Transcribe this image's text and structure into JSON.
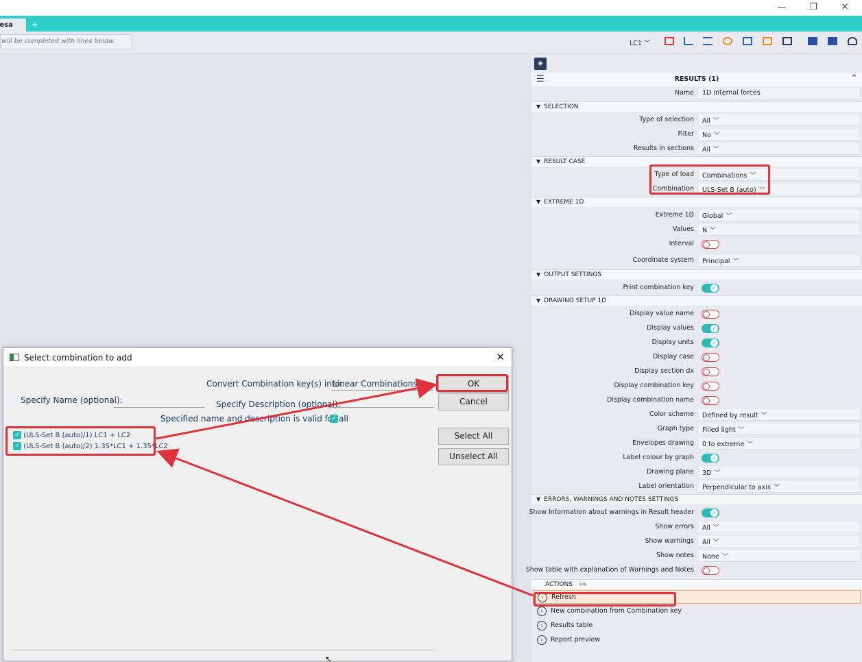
{
  "window": {
    "minimize": "—",
    "restore": "❐",
    "close": "✕"
  },
  "tabs": {
    "active_label": "Lesa",
    "add_label": "+"
  },
  "toolbar": {
    "command_hint": "will be completed with lines below.",
    "load_case": "LC1",
    "icons": [
      "frame-icon",
      "load-icon",
      "support-icon",
      "refresh-icon",
      "model-icon",
      "lock-icon",
      "view-icon",
      "flag-icon",
      "flag-icon",
      "user-settings-icon"
    ]
  },
  "panel": {
    "title": "RESULTS (1)",
    "name_label": "Name",
    "name_value": "1D internal forces",
    "sections": {
      "selection": "SELECTION",
      "result_case": "RESULT CASE",
      "extreme": "EXTREME 1D",
      "output": "OUTPUT SETTINGS",
      "drawing": "DRAWING SETUP 1D",
      "errors": "ERRORS, WARNINGS AND NOTES SETTINGS",
      "actions": "ACTIONS"
    },
    "selection_rows": [
      {
        "label": "Type of selection",
        "value": "All"
      },
      {
        "label": "Filter",
        "value": "No"
      },
      {
        "label": "Results in sections",
        "value": "All"
      }
    ],
    "result_case_rows": [
      {
        "label": "Type of load",
        "value": "Combinations"
      },
      {
        "label": "Combination",
        "value": "ULS-Set B (auto)"
      }
    ],
    "extreme_rows": [
      {
        "label": "Extreme 1D",
        "value": "Global"
      },
      {
        "label": "Values",
        "value": "N"
      },
      {
        "label": "Interval",
        "toggle": false
      }
    ],
    "coordinate_system": {
      "label": "Coordinate system",
      "value": "Principal"
    },
    "output_rows": [
      {
        "label": "Print combination key",
        "toggle": true
      }
    ],
    "drawing_rows": [
      {
        "label": "Display value name",
        "toggle": false
      },
      {
        "label": "Display values",
        "toggle": true
      },
      {
        "label": "Display units",
        "toggle": true
      },
      {
        "label": "Display case",
        "toggle": false
      },
      {
        "label": "Display section dx",
        "toggle": false
      },
      {
        "label": "Display combination key",
        "toggle": false
      },
      {
        "label": "Display combination name",
        "toggle": false
      },
      {
        "label": "Color scheme",
        "value": "Defined by result"
      },
      {
        "label": "Graph type",
        "value": "Filled light"
      },
      {
        "label": "Envelopes drawing",
        "value": "0 to extreme"
      },
      {
        "label": "Label colour by graph",
        "toggle": true
      },
      {
        "label": "Drawing plane",
        "value": "3D"
      },
      {
        "label": "Label orientation",
        "value": "Perpendicular to axis"
      }
    ],
    "errors_rows": [
      {
        "label": "Show Information about warnings in Result header",
        "toggle": true
      },
      {
        "label": "Show errors",
        "value": "All"
      },
      {
        "label": "Show warnings",
        "value": "All"
      },
      {
        "label": "Show notes",
        "value": "None"
      },
      {
        "label": "Show table with explanation of Warnings and Notes",
        "toggle": false
      }
    ],
    "actions": [
      {
        "label": "Refresh"
      },
      {
        "label": "New combination from Combination key"
      },
      {
        "label": "Results table"
      },
      {
        "label": "Report preview"
      }
    ]
  },
  "dialog": {
    "title": "Select combination to add",
    "convert_label": "Convert Combination key(s) into:",
    "convert_value": "Linear Combinations",
    "name_label": "Specify Name (optional):",
    "name_value": "",
    "description_label": "Specify Description (optional):",
    "description_value": "",
    "valid_for_all_label": "Specified name and description is valid for all",
    "ok_label": "OK",
    "cancel_label": "Cancel",
    "select_all_label": "Select All",
    "unselect_all_label": "Unselect All",
    "items": [
      "(ULS-Set B (auto)/1) LC1 + LC2",
      "(ULS-Set B (auto)/2) 1.35*LC1 + 1.35*LC2"
    ]
  },
  "colors": {
    "accent": "#2ecfcb",
    "annotation": "#e0323c",
    "toggle_on": "#2cbcb8"
  }
}
